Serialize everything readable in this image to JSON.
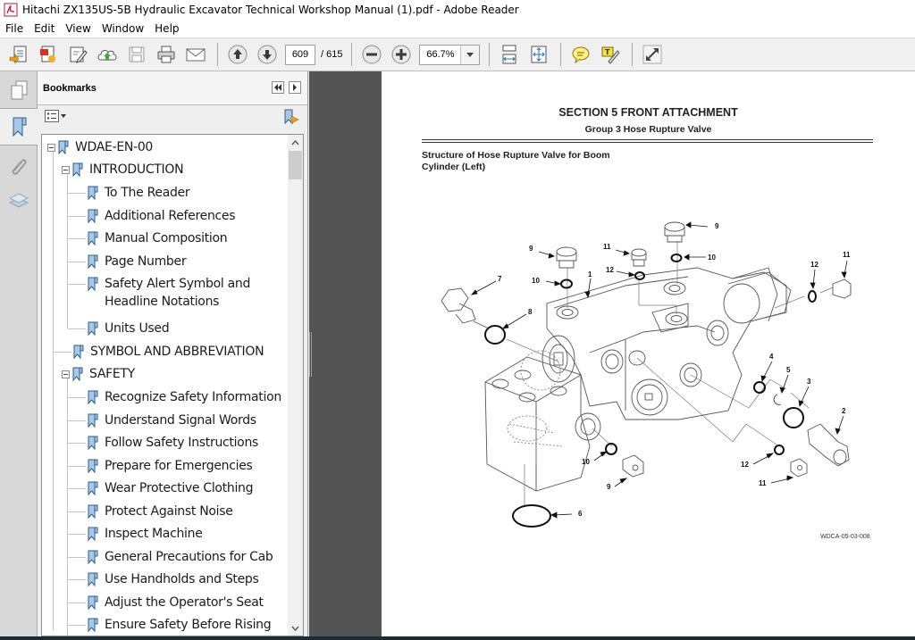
{
  "window": {
    "title": "Hitachi ZX135US-5B Hydraulic Excavator Technical Workshop Manual (1).pdf - Adobe Reader"
  },
  "menu": [
    "File",
    "Edit",
    "View",
    "Window",
    "Help"
  ],
  "toolbar": {
    "buttons": [
      "create-pdf",
      "export-pdf",
      "edit-pdf",
      "upload-cloud",
      "save",
      "print",
      "email",
      "previous-page",
      "next-page",
      "zoom-out",
      "zoom-in",
      "scroll-mode",
      "fit-page",
      "comment",
      "fill-sign",
      "full-screen"
    ],
    "current_page": "609",
    "total_pages": "/ 615",
    "zoom_level": "66.7%"
  },
  "bookmarks_panel": {
    "title": "Bookmarks",
    "items": [
      {
        "label": "WDAE-EN-00",
        "level": 0,
        "expanded": true
      },
      {
        "label": "INTRODUCTION",
        "level": 1,
        "expanded": true
      },
      {
        "label": "To The Reader",
        "level": 2
      },
      {
        "label": "Additional References",
        "level": 2
      },
      {
        "label": "Manual Composition",
        "level": 2
      },
      {
        "label": "Page Number",
        "level": 2
      },
      {
        "label": "Safety Alert Symbol and",
        "label2": "Headline Notations",
        "level": 2
      },
      {
        "label": "Units Used",
        "level": 2
      },
      {
        "label": "SYMBOL AND ABBREVIATION",
        "level": 1
      },
      {
        "label": "SAFETY",
        "level": 1,
        "expanded": true
      },
      {
        "label": "Recognize Safety Information",
        "level": 2
      },
      {
        "label": "Understand Signal Words",
        "level": 2
      },
      {
        "label": "Follow Safety Instructions",
        "level": 2
      },
      {
        "label": "Prepare for Emergencies",
        "level": 2
      },
      {
        "label": "Wear Protective Clothing",
        "level": 2
      },
      {
        "label": "Protect Against Noise",
        "level": 2
      },
      {
        "label": "Inspect Machine",
        "level": 2
      },
      {
        "label": "General Precautions for Cab",
        "level": 2
      },
      {
        "label": "Use Handholds and Steps",
        "level": 2
      },
      {
        "label": "Adjust the Operator's Seat",
        "level": 2
      },
      {
        "label": "Ensure Safety Before Rising",
        "level": 2
      }
    ]
  },
  "document": {
    "section_title": "SECTION 5 FRONT ATTACHMENT",
    "group_title": "Group 3 Hose Rupture Valve",
    "figure_heading_line1": "Structure of Hose Rupture Valve for Boom",
    "figure_heading_line2": "Cylinder (Left)",
    "figure_code": "WDCA-05-03-008",
    "callouts": [
      "1",
      "2",
      "3",
      "4",
      "5",
      "6",
      "7",
      "8",
      "9",
      "9",
      "9",
      "10",
      "10",
      "10",
      "11",
      "11",
      "11",
      "12",
      "12",
      "12"
    ]
  }
}
